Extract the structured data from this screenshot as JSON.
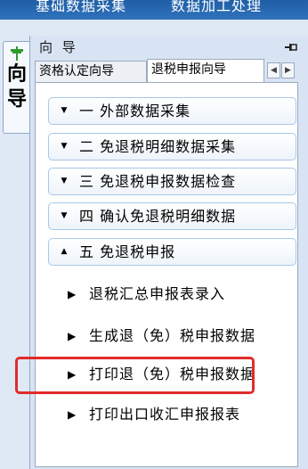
{
  "top_menu": {
    "item1": "基础数据采集",
    "item2": "数据加工处理"
  },
  "side_tab": {
    "char1": "向",
    "char2": "导"
  },
  "panel": {
    "title": "向 导"
  },
  "tabs": {
    "tab1": "资格认定向导",
    "tab2": "退税申报向导",
    "prev": "◀",
    "next": "▶"
  },
  "sections": {
    "s1": {
      "arrow": "▼",
      "label": "一  外部数据采集"
    },
    "s2": {
      "arrow": "▼",
      "label": "二  免退税明细数据采集"
    },
    "s3": {
      "arrow": "▼",
      "label": "三  免退税申报数据检查"
    },
    "s4": {
      "arrow": "▼",
      "label": "四  确认免退税明细数据"
    },
    "s5": {
      "arrow": "▲",
      "label": "五  免退税申报"
    }
  },
  "items": {
    "i1": "退税汇总申报表录入",
    "i2": "生成退（免）税申报数据",
    "i3": "打印退（免）税申报数据",
    "i4": "打印出口收汇申报报表"
  },
  "colors": {
    "highlight": "#e22b2b",
    "accent": "#1f5ea6"
  }
}
